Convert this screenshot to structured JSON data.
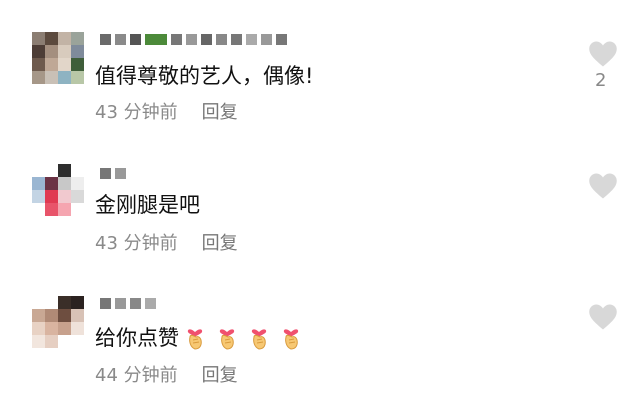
{
  "comments": [
    {
      "text": "值得尊敬的艺人，偶像!",
      "time": "43 分钟前",
      "reply": "回复",
      "likes": "2"
    },
    {
      "text": "金刚腿是吧",
      "time": "43 分钟前",
      "reply": "回复"
    },
    {
      "text": "给你点赞",
      "time": "44 分钟前",
      "reply": "回复",
      "emoji_count": 4
    }
  ],
  "icons": {
    "like": "heart-icon",
    "emoji": "finger-heart-emoji"
  },
  "colors": {
    "heart": "#d8d8d8",
    "meta_text": "#8a8a8a",
    "body_text": "#111111"
  }
}
